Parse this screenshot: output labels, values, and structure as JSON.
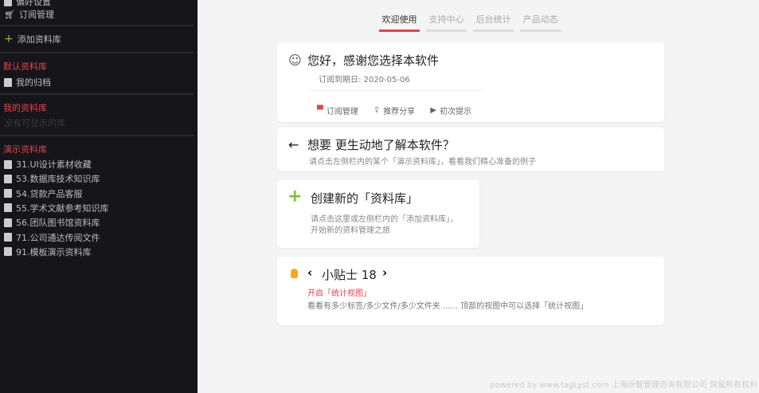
{
  "sidebar": {
    "top_item": "偏好设置",
    "subscription": "订阅管理",
    "add_library": "添加资料库",
    "default_section": "默认资料库",
    "my_archive": "我的归档",
    "my_section": "我的资料库",
    "my_empty": "没有可显示的库",
    "demo_section": "演示资料库",
    "demo_items": [
      "31.UI设计素材收藏",
      "53.数据库技术知识库",
      "54.贷款产品客服",
      "55.学术文献参考知识库",
      "56.团队图书馆资料库",
      "71.公司通达传阅文件",
      "91.模板演示资料库"
    ]
  },
  "tabs": [
    "欢迎使用",
    "支持中心",
    "后台统计",
    "产品动态"
  ],
  "welcome": {
    "title": "您好，感谢您选择本软件",
    "expiry": "订阅到期日: 2020-05-06",
    "actions": [
      "订阅管理",
      "推荐分享",
      "初次提示"
    ]
  },
  "learn": {
    "title": "想要 更生动地了解本软件？",
    "desc": "请点击左侧栏内的某个「演示资料库」，看看我们精心准备的例子"
  },
  "create": {
    "title": "创建新的「资料库」",
    "desc1": "请点击这里或左侧栏内的「添加资料库」，",
    "desc2": "开始新的资料管理之旅"
  },
  "tip": {
    "title": "小贴士 18",
    "heading": "开启「统计视图」",
    "desc": "看看有多少标签/多少文件/多少文件夹 ...... 顶部的视图中可以选择「统计视图」"
  },
  "footer": "powered by www.tagLyst.com 上海纷智管理咨询有限公司 保留所有权利"
}
